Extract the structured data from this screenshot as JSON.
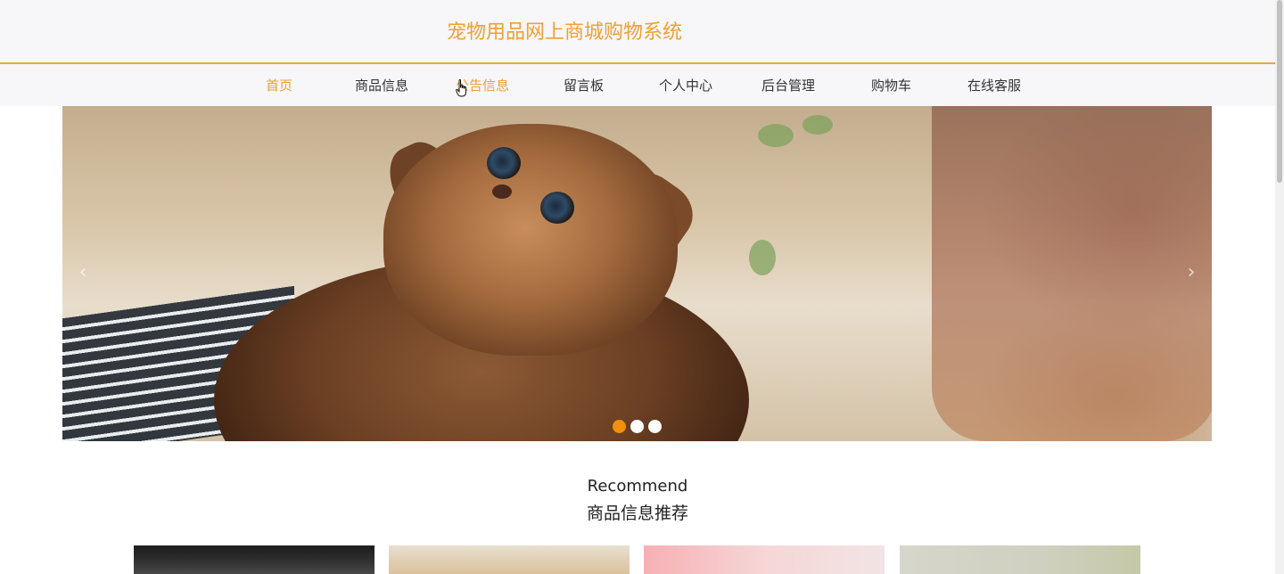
{
  "header": {
    "title": "宠物用品网上商城购物系统"
  },
  "nav": {
    "items": [
      {
        "label": "首页",
        "state": "active"
      },
      {
        "label": "商品信息",
        "state": "normal"
      },
      {
        "label": "公告信息",
        "state": "hover"
      },
      {
        "label": "留言板",
        "state": "normal"
      },
      {
        "label": "个人中心",
        "state": "normal"
      },
      {
        "label": "后台管理",
        "state": "normal"
      },
      {
        "label": "购物车",
        "state": "normal"
      },
      {
        "label": "在线客服",
        "state": "normal"
      }
    ]
  },
  "banner": {
    "slide_count": 3,
    "active_slide": 1,
    "prev_icon": "chevron-left-icon",
    "next_icon": "chevron-right-icon"
  },
  "recommend": {
    "title_en": "Recommend",
    "title_cn": "商品信息推荐",
    "card_count": 4
  },
  "colors": {
    "accent": "#f0a030",
    "header_bg": "#f7f6f9",
    "dot_active": "#f38f0e",
    "dot_inactive": "#ffffff"
  }
}
